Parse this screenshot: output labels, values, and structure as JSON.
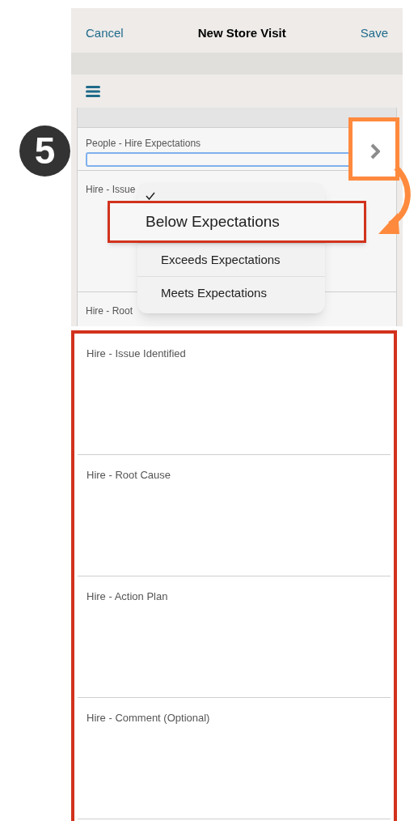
{
  "step_badge": "5",
  "header": {
    "cancel": "Cancel",
    "title": "New Store Visit",
    "save": "Save"
  },
  "form": {
    "fields": [
      {
        "label": "People - Hire Expectations",
        "focused": true
      },
      {
        "label": "Hire - Issue",
        "focused": false
      },
      {
        "label": "Hire - Root",
        "focused": false
      }
    ]
  },
  "menu": {
    "items": [
      {
        "label": "Below Expectations",
        "selected": true
      },
      {
        "label": "Exceeds Expectations",
        "selected": false
      },
      {
        "label": "Meets Expectations",
        "selected": false
      }
    ]
  },
  "detail_fields": [
    {
      "label": "Hire - Issue Identified"
    },
    {
      "label": "Hire - Root Cause"
    },
    {
      "label": "Hire - Action Plan"
    },
    {
      "label": "Hire - Comment (Optional)"
    }
  ]
}
